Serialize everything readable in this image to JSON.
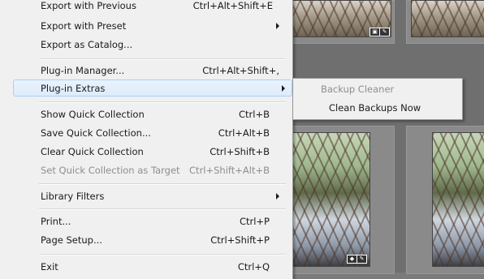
{
  "menu": {
    "items": [
      {
        "label": "Export with Previous",
        "accel": "Ctrl+Alt+Shift+E",
        "submenu": false,
        "disabled": false
      },
      {
        "label": "Export with Preset",
        "accel": "",
        "submenu": true,
        "disabled": false
      },
      {
        "label": "Export as Catalog...",
        "accel": "",
        "submenu": false,
        "disabled": false
      },
      {
        "label": "Plug-in Manager...",
        "accel": "Ctrl+Alt+Shift+,",
        "submenu": false,
        "disabled": false
      },
      {
        "label": "Plug-in Extras",
        "accel": "",
        "submenu": true,
        "disabled": false
      },
      {
        "label": "Show Quick Collection",
        "accel": "Ctrl+B",
        "submenu": false,
        "disabled": false
      },
      {
        "label": "Save Quick Collection...",
        "accel": "Ctrl+Alt+B",
        "submenu": false,
        "disabled": false
      },
      {
        "label": "Clear Quick Collection",
        "accel": "Ctrl+Shift+B",
        "submenu": false,
        "disabled": false
      },
      {
        "label": "Set Quick Collection as Target",
        "accel": "Ctrl+Shift+Alt+B",
        "submenu": false,
        "disabled": true
      },
      {
        "label": "Library Filters",
        "accel": "",
        "submenu": true,
        "disabled": false
      },
      {
        "label": "Print...",
        "accel": "Ctrl+P",
        "submenu": false,
        "disabled": false
      },
      {
        "label": "Page Setup...",
        "accel": "Ctrl+Shift+P",
        "submenu": false,
        "disabled": false
      },
      {
        "label": "Exit",
        "accel": "Ctrl+Q",
        "submenu": false,
        "disabled": false
      }
    ],
    "highlighted": "Plug-in Extras"
  },
  "submenu": {
    "items": [
      {
        "label": "Backup Cleaner",
        "disabled": true
      },
      {
        "label": "Clean Backups Now",
        "disabled": false
      }
    ]
  },
  "colors": {
    "menu_bg": "#f0f0f0",
    "highlight_border": "#a9d0f5",
    "disabled_text": "#8d8d8d",
    "background": "#7b7b7b"
  }
}
